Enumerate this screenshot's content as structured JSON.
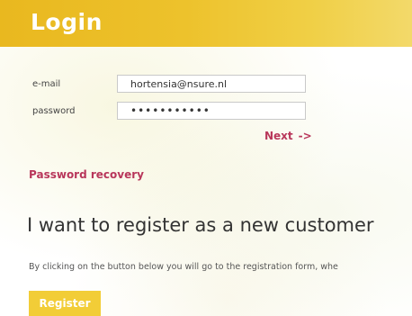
{
  "header": {
    "title": "Login"
  },
  "form": {
    "email_label": "e-mail",
    "email_value": "hortensia@nsure.nl",
    "password_label": "password",
    "password_value": "•••••••••••",
    "next_label": "Next",
    "next_arrow": "->",
    "recovery_label": "Password recovery"
  },
  "register": {
    "heading": "I want to register as a new customer",
    "description": "By clicking on the button below you will go to the registration form, whe",
    "button_label": "Register"
  },
  "colors": {
    "header_yellow": "#edc22c",
    "link_red": "#b8365a",
    "button_yellow": "#f2cd37"
  }
}
